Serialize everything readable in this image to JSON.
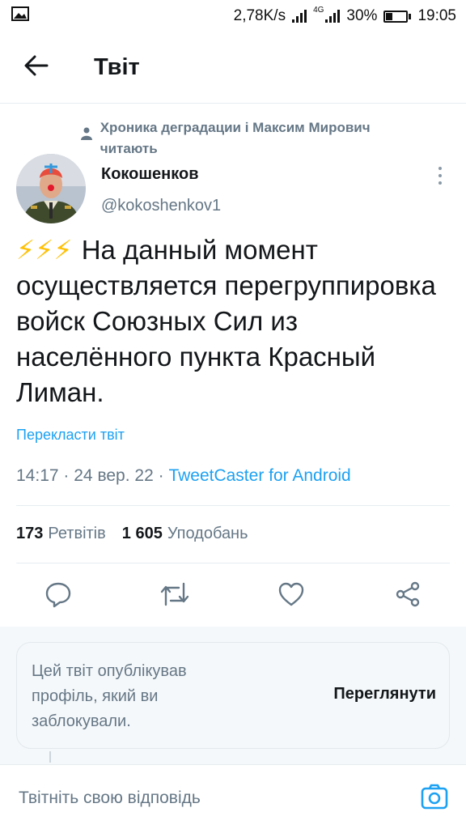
{
  "status_bar": {
    "speed": "2,78K/s",
    "network": "4G",
    "battery": "30%",
    "battery_level": 0.3,
    "time": "19:05"
  },
  "header": {
    "title": "Твіт",
    "back_icon": "arrow-left-icon"
  },
  "tweet": {
    "social_context": "Хроника деградации і Максим Мирович читають",
    "author_name": "Кокошенков",
    "author_handle": "@kokoshenkov1",
    "emoji": "⚡⚡⚡",
    "text": "На данный момент осуществляется перегруппировка войск Союзных Сил из населённого пункта Красный Лиман.",
    "translate_label": "Перекласти твіт",
    "time": "14:17",
    "separator": "·",
    "date": "24 вер. 22",
    "via": "TweetCaster for Android",
    "retweets_count": "173",
    "retweets_label": "Ретвітів",
    "likes_count": "1 605",
    "likes_label": "Уподобань"
  },
  "actions": [
    {
      "icon": "reply-icon"
    },
    {
      "icon": "retweet-icon"
    },
    {
      "icon": "like-icon"
    },
    {
      "icon": "share-icon"
    }
  ],
  "blocked_notice": {
    "message": "Цей твіт опублікував профіль, який ви заблокували.",
    "view_label": "Переглянути"
  },
  "reply_bar": {
    "placeholder": "Твітніть свою відповідь",
    "camera_icon": "camera-icon"
  },
  "colors": {
    "accent": "#1da1f2",
    "secondary_text": "#657786",
    "divider": "#e6ecf0",
    "bolt": "#ffc107"
  }
}
